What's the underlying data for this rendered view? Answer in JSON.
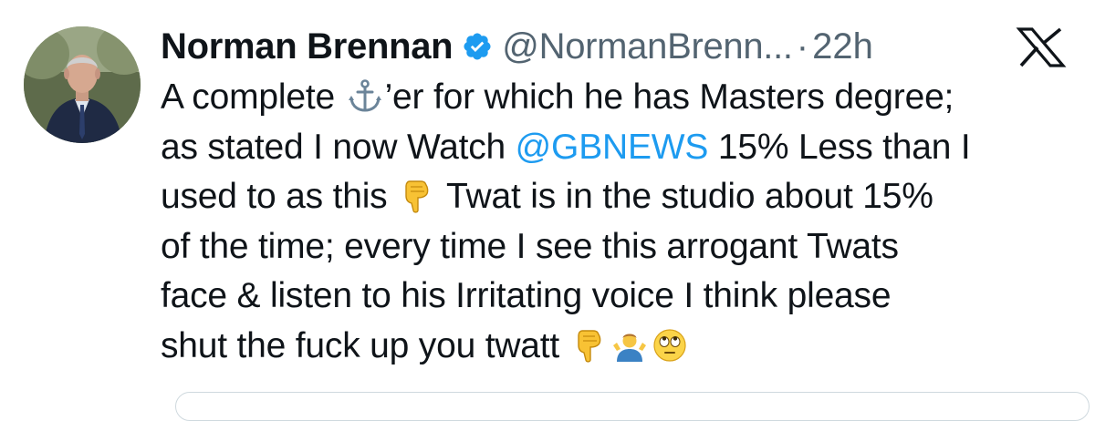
{
  "tweet": {
    "author": {
      "display_name": "Norman Brennan",
      "handle": "@NormanBrenn...",
      "verified": true
    },
    "separator": "·",
    "time": "22h",
    "brand": "x-logo-icon",
    "lines": [
      {
        "before": "A complete ",
        "emoji": "anchor-emoji-icon",
        "after": "’er for which he has Masters degree;"
      },
      {
        "before": "as stated I now Watch ",
        "mention": "@GBNEWS",
        "after": " 15% Less than I"
      },
      {
        "before": "used to as this ",
        "emoji": "backhand-index-pointing-down-emoji-icon",
        "after": " Twat is in the studio about 15%"
      },
      {
        "text": "of the time; every time I see this arrogant Twats"
      },
      {
        "text": "face & listen to his Irritating voice I think please"
      },
      {
        "text": "shut the fuck up you twatt"
      }
    ],
    "trailing_emojis": [
      "backhand-index-pointing-down-emoji-icon",
      "man-shrugging-emoji-icon",
      "face-with-rolling-eyes-emoji-icon"
    ]
  },
  "colors": {
    "text": "#0f1419",
    "secondary": "#536471",
    "link": "#1d9bf0",
    "verified_badge": "#1d9bf0"
  }
}
